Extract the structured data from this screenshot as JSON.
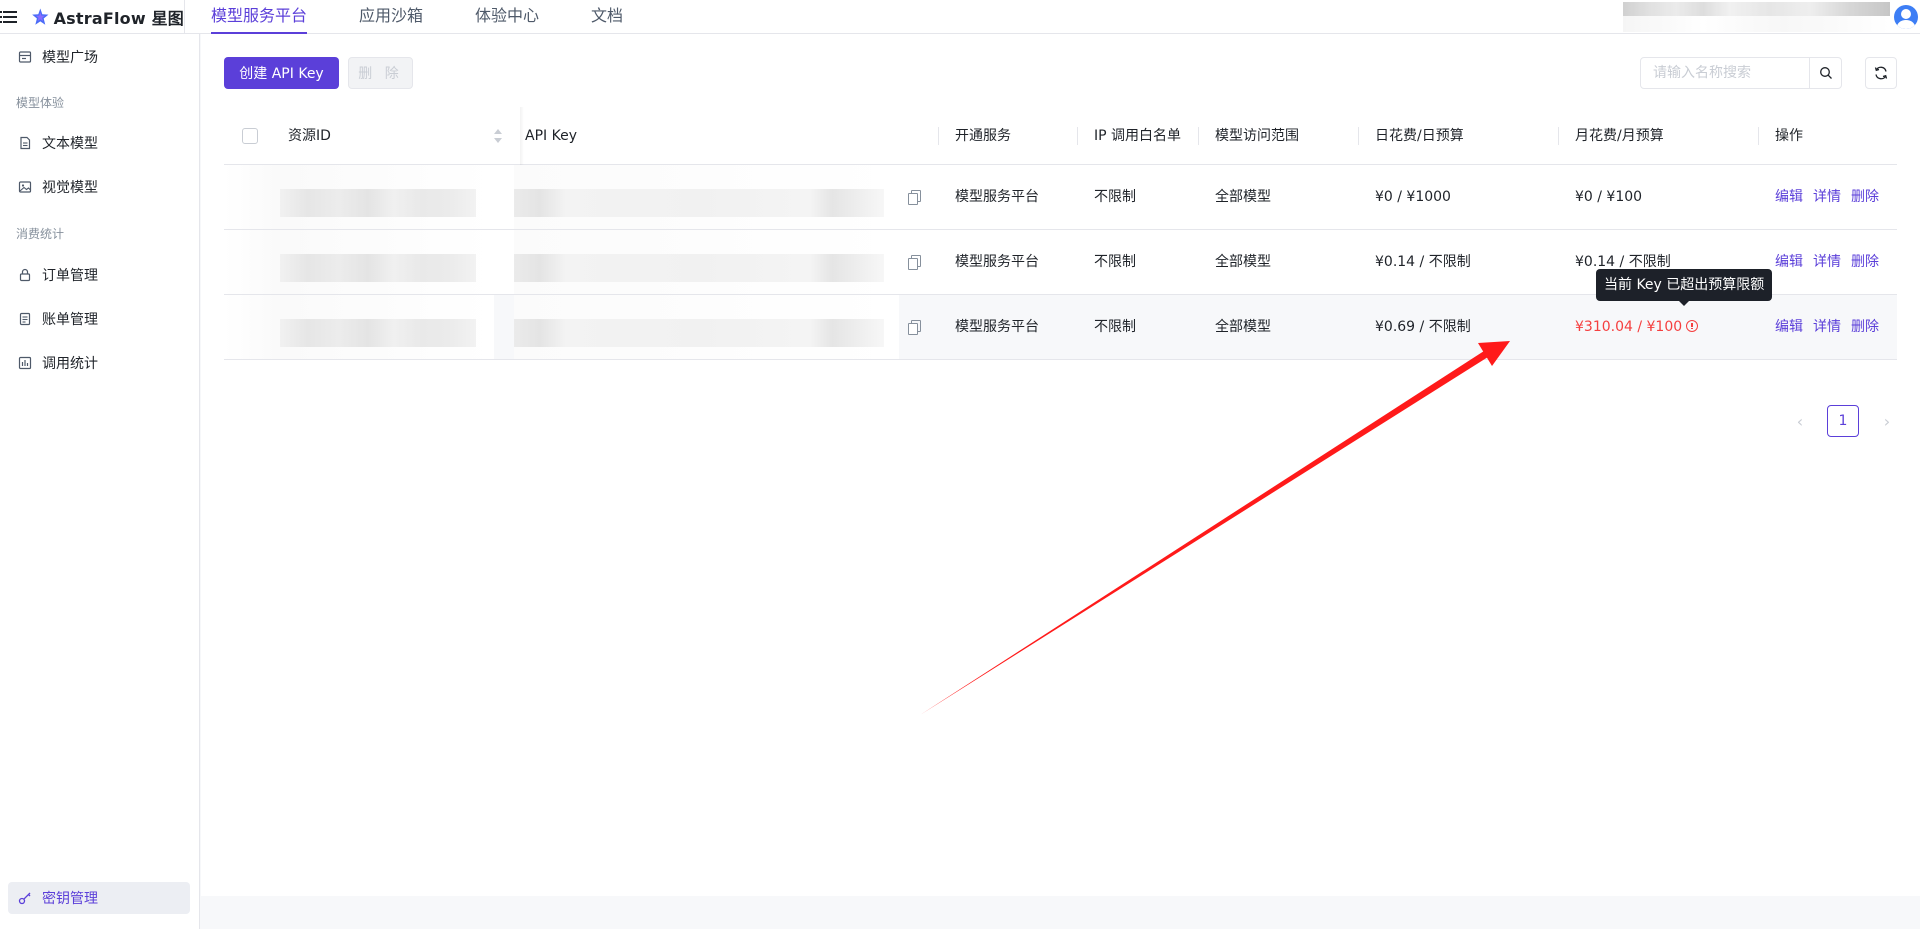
{
  "header": {
    "app_name": "AstraFlow 星图",
    "nav": [
      {
        "label": "模型服务平台",
        "active": true
      },
      {
        "label": "应用沙箱",
        "active": false
      },
      {
        "label": "体验中心",
        "active": false
      },
      {
        "label": "文档",
        "active": false
      }
    ]
  },
  "sidebar": {
    "items": [
      {
        "label": "模型广场",
        "icon": "store-icon"
      },
      {
        "group": "模型体验"
      },
      {
        "label": "文本模型",
        "icon": "document-icon"
      },
      {
        "label": "视觉模型",
        "icon": "image-icon"
      },
      {
        "group": "消费统计"
      },
      {
        "label": "订单管理",
        "icon": "lock-icon"
      },
      {
        "label": "账单管理",
        "icon": "bill-icon"
      },
      {
        "label": "调用统计",
        "icon": "bar-chart-icon"
      },
      {
        "label": "密钥管理",
        "icon": "key-icon",
        "active": true
      }
    ]
  },
  "toolbar": {
    "create_label": "创建 API Key",
    "delete_label": "删 除",
    "search_placeholder": "请输入名称搜索"
  },
  "table": {
    "columns": [
      "资源ID",
      "API Key",
      "开通服务",
      "IP 调用白名单",
      "模型访问范围",
      "日花费/日预算",
      "月花费/月预算",
      "操作"
    ],
    "rows": [
      {
        "service": "模型服务平台",
        "ip": "不限制",
        "scope": "全部模型",
        "daily": "¥0 / ¥1000",
        "monthly": "¥0 / ¥100",
        "over_budget": false
      },
      {
        "service": "模型服务平台",
        "ip": "不限制",
        "scope": "全部模型",
        "daily": "¥0.14 / 不限制",
        "monthly": "¥0.14 / 不限制",
        "over_budget": false
      },
      {
        "service": "模型服务平台",
        "ip": "不限制",
        "scope": "全部模型",
        "daily": "¥0.69 / 不限制",
        "monthly": "¥310.04 / ¥100",
        "over_budget": true
      }
    ],
    "actions": {
      "edit": "编辑",
      "detail": "详情",
      "delete": "删除"
    }
  },
  "tooltip": "当前 Key 已超出预算限额",
  "pagination": {
    "current": "1"
  },
  "colors": {
    "primary": "#5b3fd9",
    "danger": "#f53f3f",
    "annotation_arrow": "#ff1a1a"
  }
}
